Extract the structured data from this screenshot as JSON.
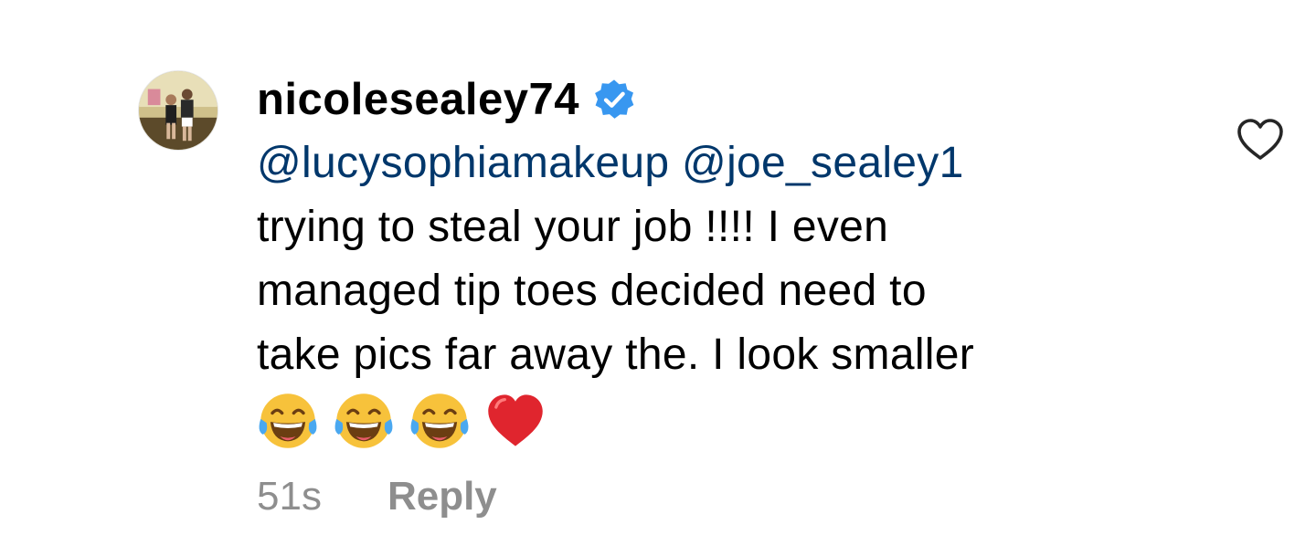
{
  "comment": {
    "username": "nicolesealey74",
    "verified": true,
    "mentions": [
      "@lucysophiamakeup",
      "@joe_sealey1"
    ],
    "text_lines": [
      "trying to steal your job !!!! I even",
      "managed tip toes decided need to",
      "take pics far away the. I look smaller"
    ],
    "emojis": [
      "face-with-tears-of-joy",
      "face-with-tears-of-joy",
      "face-with-tears-of-joy",
      "red-heart"
    ],
    "timestamp": "51s",
    "reply_label": "Reply"
  },
  "icons": {
    "verified_badge": "verified-badge-icon",
    "like": "heart-outline-icon"
  },
  "colors": {
    "mention": "#00376b",
    "meta": "#8e8e8e",
    "verified": "#3897f0",
    "heart": "#e0245e"
  }
}
